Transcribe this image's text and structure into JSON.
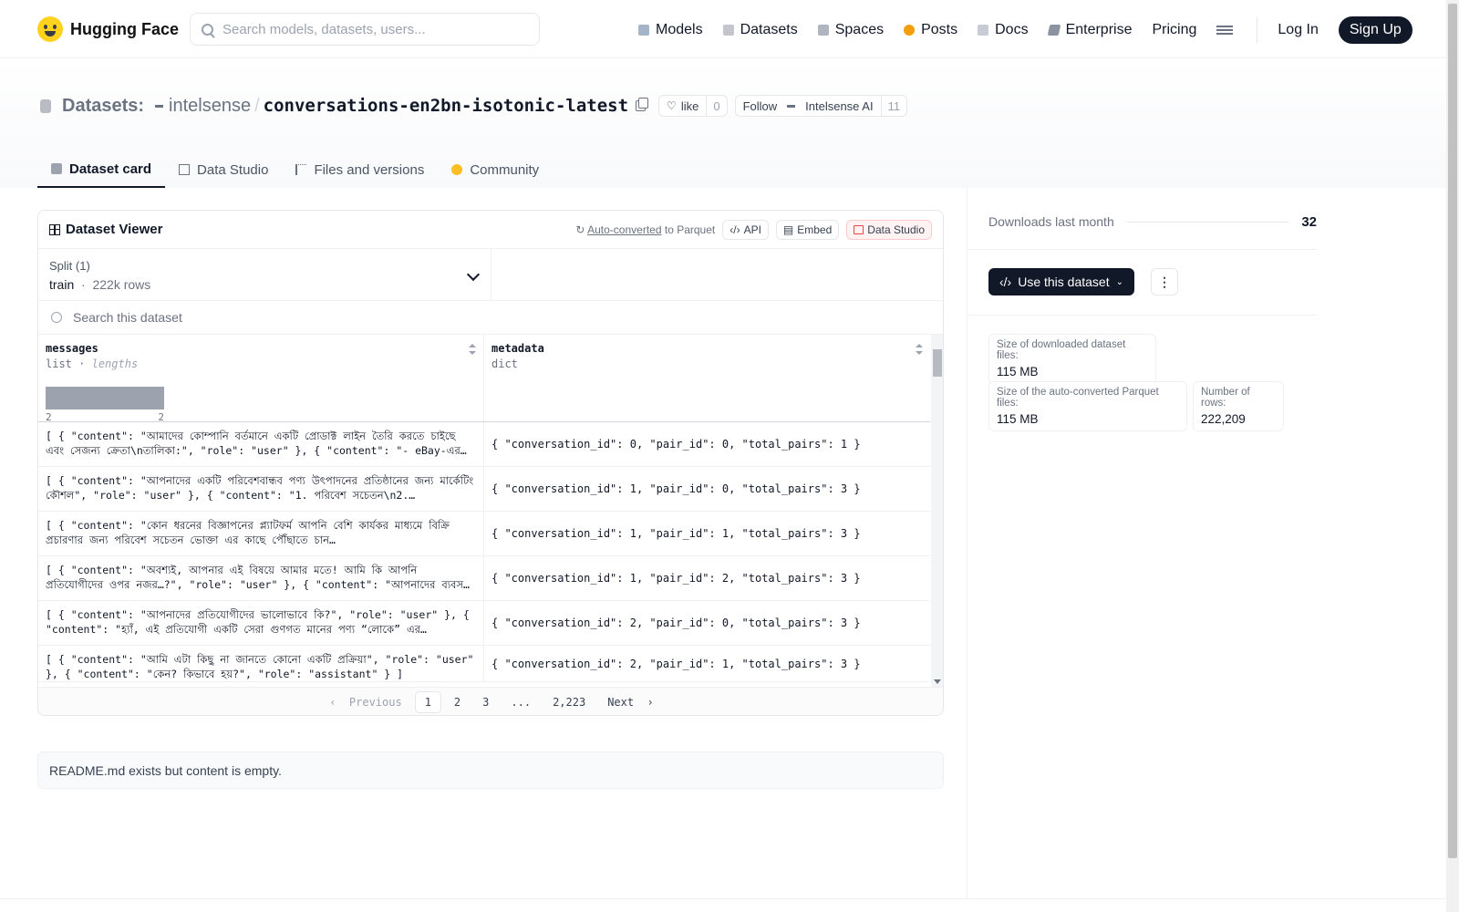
{
  "nav": {
    "logo_text": "Hugging Face",
    "search_placeholder": "Search models, datasets, users...",
    "links": [
      "Models",
      "Datasets",
      "Spaces",
      "Posts",
      "Docs",
      "Enterprise",
      "Pricing"
    ],
    "login": "Log In",
    "signup": "Sign Up"
  },
  "header": {
    "type_label": "Datasets:",
    "org": "intelsense",
    "name": "conversations-en2bn-isotonic-latest",
    "like_label": "like",
    "like_count": "0",
    "follow_label": "Follow",
    "follow_org": "Intelsense AI",
    "follow_count": "11",
    "tabs": [
      "Dataset card",
      "Data Studio",
      "Files and versions",
      "Community"
    ]
  },
  "viewer": {
    "title": "Dataset Viewer",
    "autoconv_link": "Auto-converted",
    "autoconv_rest": "to Parquet",
    "api": "API",
    "embed": "Embed",
    "studio": "Data Studio",
    "split_label": "Split (1)",
    "split_name": "train",
    "split_dot": "·",
    "split_rows": "222k rows",
    "search_placeholder": "Search this dataset",
    "columns": [
      {
        "name": "messages",
        "type": "list",
        "sub": "lengths",
        "hist_min": "2",
        "hist_max": "2"
      },
      {
        "name": "metadata",
        "type": "dict"
      }
    ],
    "rows": [
      {
        "messages": "[ { \"content\": \"আমাদের কোম্পানি বর্তমানে একটি প্রোডাক্ট লাইন তৈরি করতে চাইছে এবং সেজন্য ক্রেতা\\nতালিকা:\", \"role\": \"user\" }, { \"content\": \"- eBay-এর…",
        "metadata": "{ \"conversation_id\": 0, \"pair_id\": 0, \"total_pairs\": 1 }"
      },
      {
        "messages": "[ { \"content\": \"আপনাদের একটি পরিবেশবান্ধব পণ্য উৎপাদনের প্রতিষ্ঠানের জন্য মার্কেটিং কৌশল\", \"role\": \"user\" }, { \"content\": \"1. পরিবেশ সচেতন\\n2.…",
        "metadata": "{ \"conversation_id\": 1, \"pair_id\": 0, \"total_pairs\": 3 }"
      },
      {
        "messages": "[ { \"content\": \"কোন ধরনের বিজ্ঞাপনের প্ল্যাটফর্ম আপনি বেশি কার্যকর মাধ্যমে বিক্রি প্রচারণার জন্য পরিবেশ সচেতন ভোক্তা এর কাছে পৌঁছাতে চান…",
        "metadata": "{ \"conversation_id\": 1, \"pair_id\": 1, \"total_pairs\": 3 }"
      },
      {
        "messages": "[ { \"content\": \"অবশ্যই, আপনার এই বিষয়ে আমার মতে! আমি কি আপনি প্রতিযোগীদের ওপর নজর…?\", \"role\": \"user\" }, { \"content\": \"আপনাদের ব্যবস…",
        "metadata": "{ \"conversation_id\": 1, \"pair_id\": 2, \"total_pairs\": 3 }"
      },
      {
        "messages": "[ { \"content\": \"আপনাদের প্রতিযোগীদের ভালোভাবে কি?\", \"role\": \"user\" }, { \"content\": \"হ্যাঁ, এই প্রতিযোগী একটি সেরা গুণগত মানের পণ্য “লোকে” এর…",
        "metadata": "{ \"conversation_id\": 2, \"pair_id\": 0, \"total_pairs\": 3 }"
      },
      {
        "messages": "[ { \"content\": \"আমি এটা কিছু না জানতে কোনো একটি প্রক্রিয়া\", \"role\": \"user\" }, { \"content\": \"কেন? কিভাবে হয়?\", \"role\": \"assistant\" } ]",
        "metadata": "{ \"conversation_id\": 2, \"pair_id\": 1, \"total_pairs\": 3 }"
      }
    ],
    "pager": {
      "prev": "Previous",
      "pages": [
        "1",
        "2",
        "3",
        "...",
        "2,223"
      ],
      "next": "Next",
      "current": "1"
    }
  },
  "readme_text": "README.md exists but content is empty.",
  "sidebar": {
    "downloads_label": "Downloads last month",
    "downloads_value": "32",
    "use_button": "Use this dataset",
    "stats": [
      {
        "label": "Size of downloaded dataset files:",
        "value": "115 MB"
      },
      {
        "label": "Size of the auto-converted Parquet files:",
        "value": "115 MB"
      },
      {
        "label": "Number of rows:",
        "value": "222,209"
      }
    ]
  },
  "colors": {
    "accent_dark": "#111827",
    "studio_red": "#ef4444",
    "hf_yellow": "#ffd21e"
  }
}
